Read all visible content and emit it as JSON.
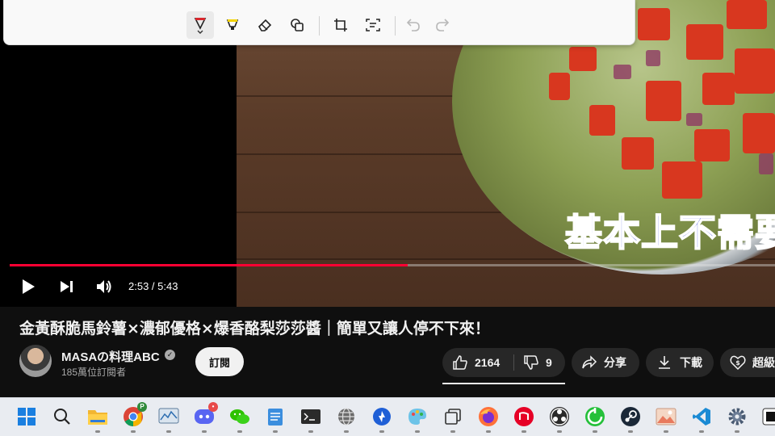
{
  "snip_toolbar": {
    "tools": [
      "ballpoint-pen",
      "highlighter",
      "eraser",
      "shapes",
      "crop",
      "text-actions",
      "undo",
      "redo"
    ]
  },
  "video": {
    "subtitle": "基本上不需要",
    "progress_percent": 52.0,
    "time": "2:53 / 5:43"
  },
  "info": {
    "title": "金黃酥脆馬鈴薯×濃郁優格×爆香酪梨莎莎醬｜簡單又讓人停不下來！",
    "channel_name": "MASAの料理ABC",
    "subscribers": "185萬位訂閱者",
    "subscribe_label": "訂閱",
    "like_count": "2164",
    "dislike_count": "9",
    "share_label": "分享",
    "download_label": "下載",
    "thanks_label": "超級"
  },
  "taskbar": {
    "apps": [
      "start",
      "search",
      "file-explorer",
      "chrome",
      "stock-monitor",
      "discord",
      "wechat",
      "notepad",
      "terminal",
      "globe",
      "app-blue",
      "paint",
      "task-view",
      "firefox",
      "netease-music",
      "obs",
      "green-app",
      "steam",
      "photos",
      "vscode",
      "settings",
      "terminal-active"
    ],
    "badges": {
      "chrome": "P",
      "discord": "•"
    }
  }
}
